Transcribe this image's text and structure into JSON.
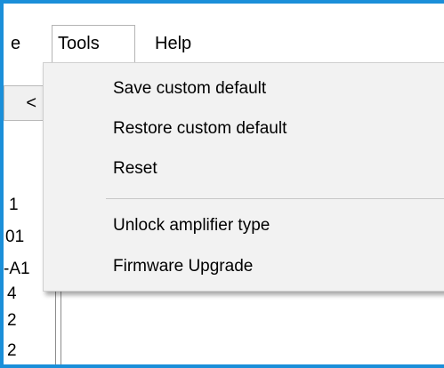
{
  "menubar": {
    "file_partial": "e",
    "tools": "Tools",
    "help": "Help"
  },
  "left_panel": {
    "collapse_label": "<",
    "items": [
      "1",
      "01",
      "-A1",
      "4",
      "2",
      "2"
    ]
  },
  "tools_menu": {
    "items": [
      {
        "label": "Save custom default"
      },
      {
        "label": "Restore custom default"
      },
      {
        "label": "Reset"
      },
      {
        "label": "Unlock amplifier type"
      },
      {
        "label": "Firmware Upgrade"
      }
    ]
  },
  "colors": {
    "frame_border": "#1b8fd9",
    "menu_background": "#f2f2f2"
  }
}
